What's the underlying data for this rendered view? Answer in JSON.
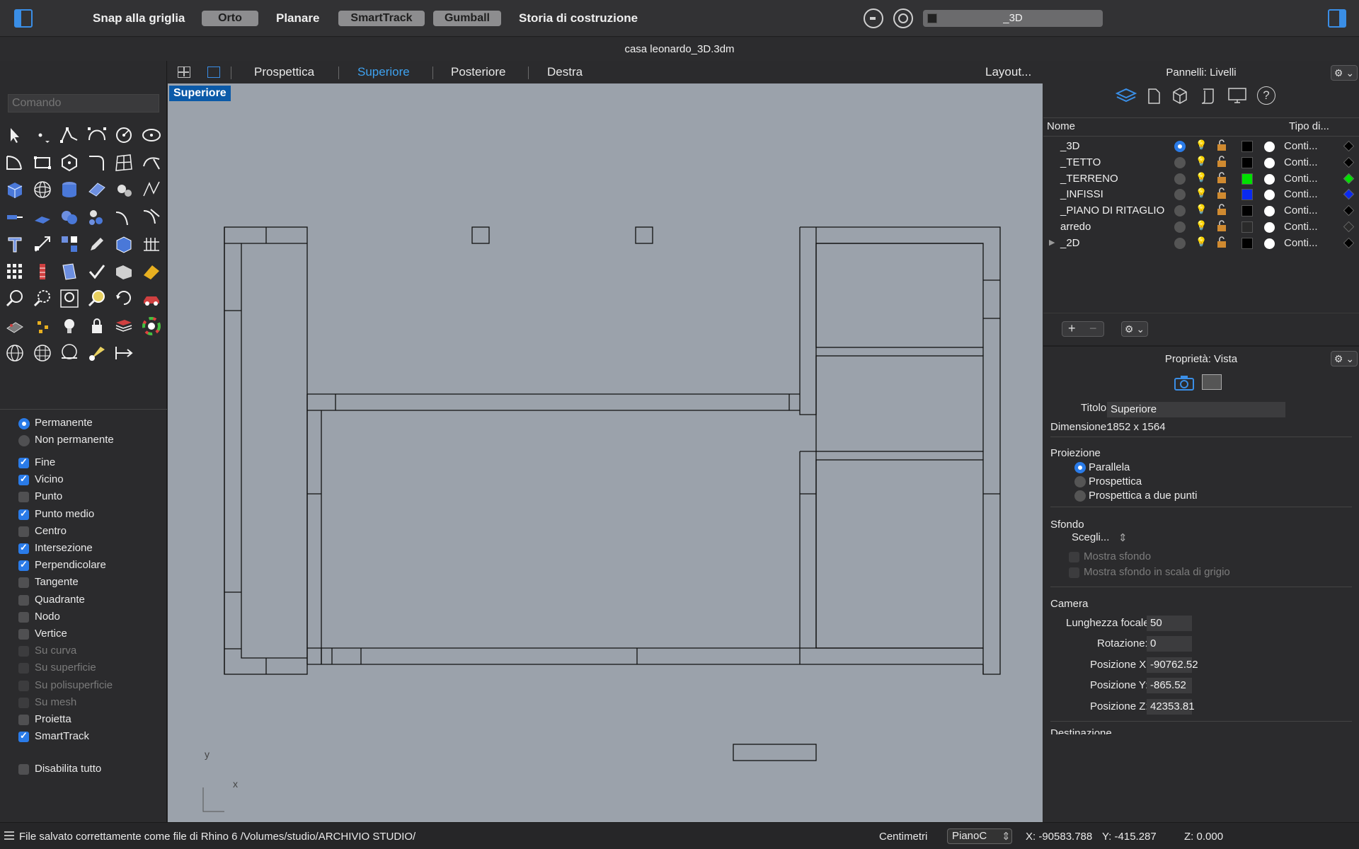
{
  "toolbar": {
    "snap_grid": "Snap alla griglia",
    "orto": "Orto",
    "planare": "Planare",
    "smarttrack": "SmartTrack",
    "gumball": "Gumball",
    "storia": "Storia di costruzione",
    "current_layer": "_3D"
  },
  "file_title": "casa leonardo_3D.3dm",
  "command": {
    "placeholder": "Comando"
  },
  "viewport_tabs": {
    "prospettica": "Prospettica",
    "superiore": "Superiore",
    "posteriore": "Posteriore",
    "destra": "Destra",
    "layout": "Layout...",
    "active": "Superiore"
  },
  "viewport": {
    "label": "Superiore",
    "axis_y": "y",
    "axis_x": "x"
  },
  "osnap": {
    "permanente": "Permanente",
    "non_permanente": "Non permanente",
    "items": [
      {
        "label": "Fine",
        "checked": true,
        "enabled": true
      },
      {
        "label": "Vicino",
        "checked": true,
        "enabled": true
      },
      {
        "label": "Punto",
        "checked": false,
        "enabled": true
      },
      {
        "label": "Punto medio",
        "checked": true,
        "enabled": true
      },
      {
        "label": "Centro",
        "checked": false,
        "enabled": true
      },
      {
        "label": "Intersezione",
        "checked": true,
        "enabled": true
      },
      {
        "label": "Perpendicolare",
        "checked": true,
        "enabled": true
      },
      {
        "label": "Tangente",
        "checked": false,
        "enabled": true
      },
      {
        "label": "Quadrante",
        "checked": false,
        "enabled": true
      },
      {
        "label": "Nodo",
        "checked": false,
        "enabled": true
      },
      {
        "label": "Vertice",
        "checked": false,
        "enabled": true
      },
      {
        "label": "Su curva",
        "checked": false,
        "enabled": false
      },
      {
        "label": "Su superficie",
        "checked": false,
        "enabled": false
      },
      {
        "label": "Su polisuperficie",
        "checked": false,
        "enabled": false
      },
      {
        "label": "Su mesh",
        "checked": false,
        "enabled": false
      },
      {
        "label": "Proietta",
        "checked": false,
        "enabled": true
      },
      {
        "label": "SmartTrack",
        "checked": true,
        "enabled": true
      }
    ],
    "disable_all": "Disabilita tutto"
  },
  "layers_panel": {
    "title": "Pannelli: Livelli",
    "col_name": "Nome",
    "col_type": "Tipo di...",
    "rows": [
      {
        "name": "_3D",
        "current": true,
        "color": "#000000",
        "type": "Conti...",
        "diamond": "#000000"
      },
      {
        "name": "_TETTO",
        "current": false,
        "color": "#000000",
        "type": "Conti...",
        "diamond": "#000000"
      },
      {
        "name": "_TERRENO",
        "current": false,
        "color": "#00e000",
        "type": "Conti...",
        "diamond": "#00e000"
      },
      {
        "name": "_INFISSI",
        "current": false,
        "color": "#0a2af0",
        "type": "Conti...",
        "diamond": "#0a2af0"
      },
      {
        "name": "_PIANO DI RITAGLIO",
        "current": false,
        "color": "#000000",
        "type": "Conti...",
        "diamond": "#000000"
      },
      {
        "name": "arredo",
        "current": false,
        "color": "#2a2a2a",
        "type": "Conti...",
        "diamond": "#2a2a2a"
      },
      {
        "name": "_2D",
        "current": false,
        "color": "#000000",
        "type": "Conti...",
        "diamond": "#000000"
      }
    ]
  },
  "properties": {
    "title": "Proprietà: Vista",
    "titolo_label": "Titolo:",
    "titolo_value": "Superiore",
    "dimensione_label": "Dimensione:",
    "dimensione_value": "1852 x 1564",
    "proiezione": "Proiezione",
    "parallela": "Parallela",
    "prospettica": "Prospettica",
    "prospettica_due": "Prospettica a due punti",
    "sfondo": "Sfondo",
    "scegli": "Scegli...",
    "mostra_sfondo": "Mostra sfondo",
    "mostra_sfondo_grigio": "Mostra sfondo in scala di grigio",
    "camera": "Camera",
    "focale_label": "Lunghezza focale:",
    "focale_value": "50",
    "rotazione_label": "Rotazione:",
    "rotazione_value": "0",
    "posx_label": "Posizione X:",
    "posx_value": "-90762.52",
    "posy_label": "Posizione Y:",
    "posy_value": "-865.52",
    "posz_label": "Posizione Z:",
    "posz_value": "42353.81",
    "destinazione": "Destinazione"
  },
  "status": {
    "message": "File salvato correttamente come file di Rhino 6 /Volumes/studio/ARCHIVIO STUDIO/",
    "units": "Centimetri",
    "plane": "PianoC",
    "x": "X: -90583.788",
    "y": "Y: -415.287",
    "z": "Z: 0.000"
  },
  "colors": {
    "accent": "#3a8ee6",
    "viewport_bg": "#9ba2ab",
    "active_tab": "#3ea2f0"
  }
}
